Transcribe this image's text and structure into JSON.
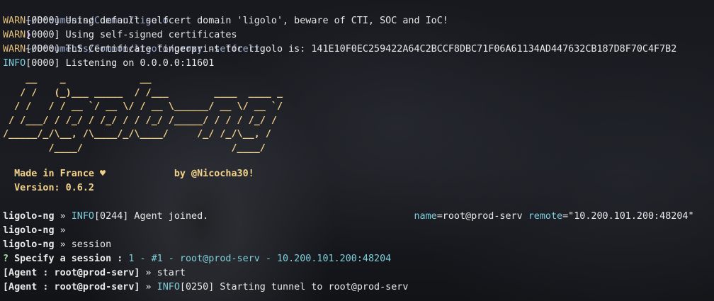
{
  "command_line": {
    "cwd": "~/Documents/Common/ligolo",
    "chevron": "❯",
    "command": "~/Documents/Common/ligolo/proxy -selfcert"
  },
  "log": [
    {
      "level": "WARN",
      "code": "[0000]",
      "text": " Using default selfcert domain 'ligolo', beware of CTI, SOC and IoC!"
    },
    {
      "level": "WARN",
      "code": "[0000]",
      "text": " Using self-signed certificates"
    },
    {
      "level": "WARN",
      "code": "[0000]",
      "text": " TLS Certificate fingerprint for ligolo is: 141E10F0EC259422A64C2BCCF8DBC71F06A61134AD447632CB187D8F70C4F7B2"
    },
    {
      "level": "INFO",
      "code": "[0000]",
      "text": " Listening on 0.0.0.0:11601"
    }
  ],
  "banner": [
    "    __    _             __",
    "   / /   (_)___ _____  / /___        ____  ____ _",
    "  / /   / / __ `/ __ \\/ / __ \\______/ __ \\/ __ `/",
    " / /___/ / /_/ / /_/ / / /_/ /_____/ / / / /_/ /",
    "/_____/_/\\__, /\\____/_/\\____/     /_/ /_/\\__, /",
    "        /____/                          /____/"
  ],
  "credits": {
    "made_in": "  Made in France ♥            by @Nicocha30!",
    "version": "  Version: 0.6.2"
  },
  "session": {
    "prompt": "ligolo-ng",
    "sep": " » ",
    "line1": {
      "level": "INFO",
      "code": "[0244]",
      "text": " Agent joined.",
      "pad": "                                    ",
      "name_key": "name",
      "name_val": "=root@prod-serv ",
      "remote_key": "remote",
      "remote_val": "=\"10.200.101.200:48204\""
    },
    "line3_cmd": "session",
    "specify": {
      "q": "? ",
      "label": "Specify a session : ",
      "value": "1 - #1 - root@prod-serv - 10.200.101.200:48204"
    },
    "agent_prompt": "[Agent : root@prod-serv]",
    "start_cmd": "start",
    "last": {
      "level": "INFO",
      "code": "[0250]",
      "text": " Starting tunnel to root@prod-serv"
    }
  }
}
